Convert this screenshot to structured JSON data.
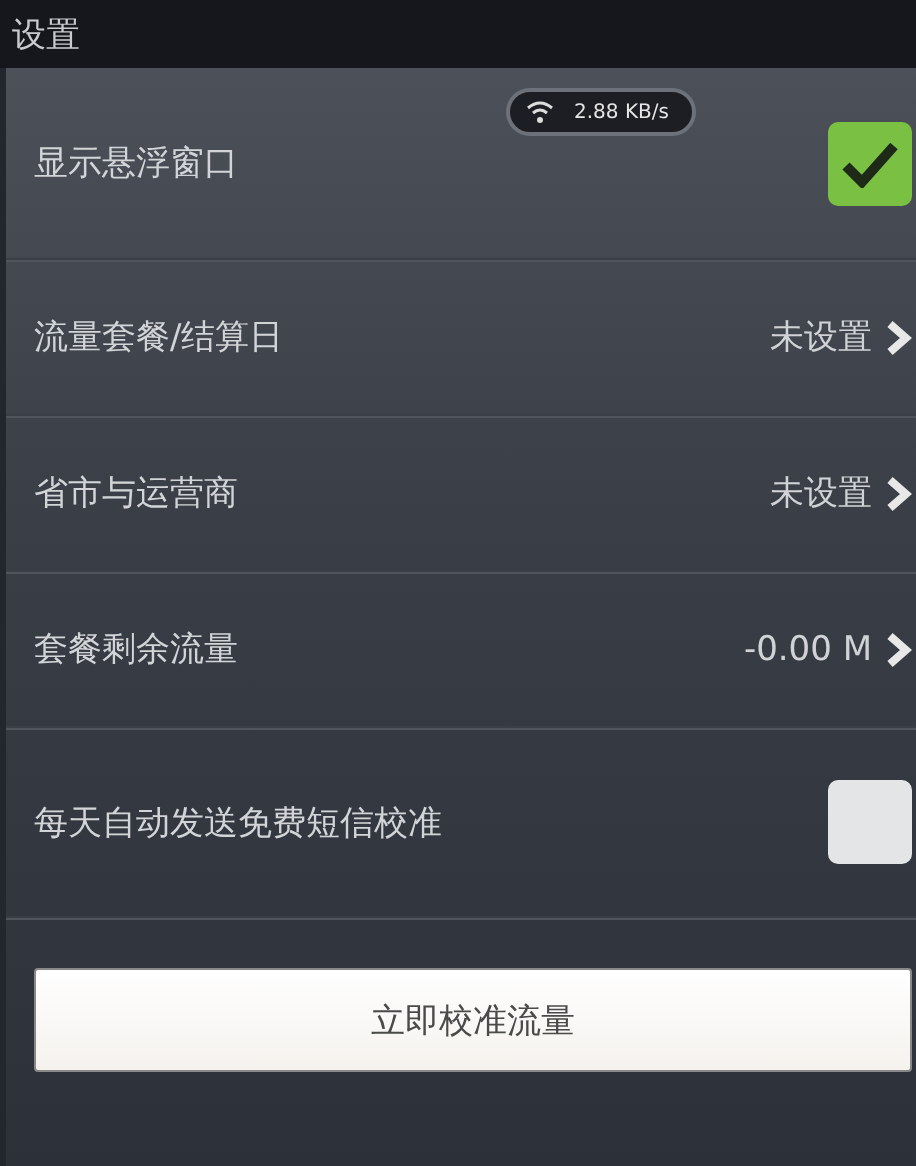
{
  "header": {
    "title": "设置"
  },
  "float_badge": {
    "speed": "2.88 KB/s"
  },
  "rows": [
    {
      "kind": "checkbox",
      "label": "显示悬浮窗口",
      "checked": true
    },
    {
      "kind": "link",
      "label": "流量套餐/结算日",
      "value": "未设置"
    },
    {
      "kind": "link",
      "label": "省市与运营商",
      "value": "未设置"
    },
    {
      "kind": "link",
      "label": "套餐剩余流量",
      "value": "-0.00 M"
    },
    {
      "kind": "checkbox",
      "label": "每天自动发送免费短信校准",
      "checked": false
    }
  ],
  "button": {
    "label": "立即校准流量"
  }
}
